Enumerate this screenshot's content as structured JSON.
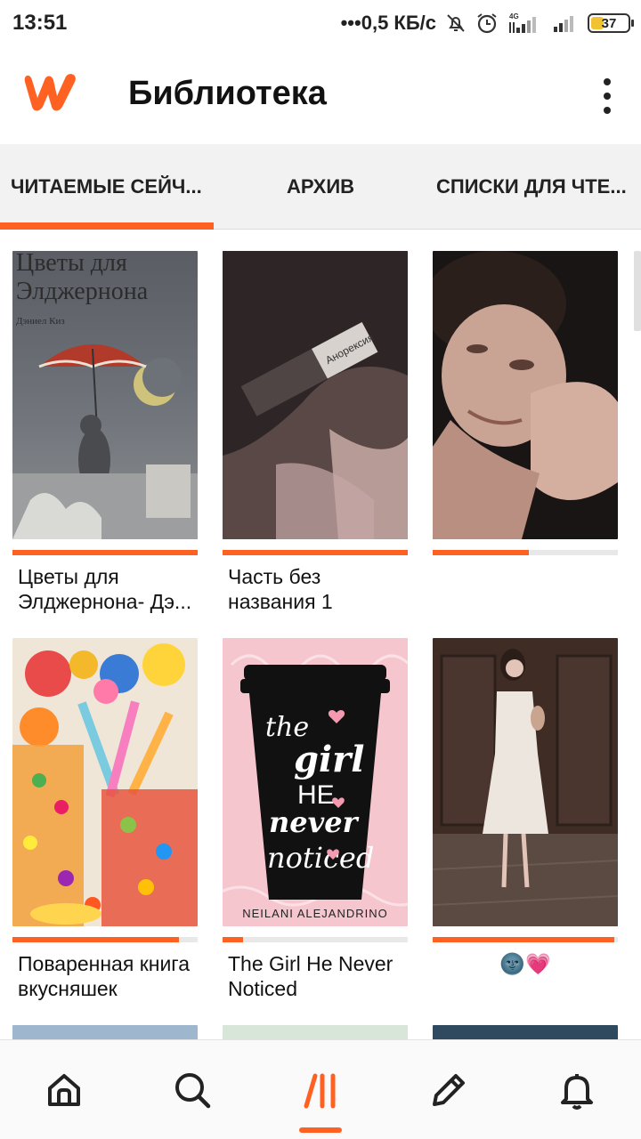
{
  "status_bar": {
    "time": "13:51",
    "speed": "•••0,5 КБ/с",
    "network": "4G",
    "battery": "37"
  },
  "app_bar": {
    "title": "Библиотека",
    "brand_color": "#ff6122"
  },
  "tabs": [
    {
      "label": "ЧИТАЕМЫЕ СЕЙЧ...",
      "active": true
    },
    {
      "label": "АРХИВ",
      "active": false
    },
    {
      "label": "СПИСКИ ДЛЯ ЧТЕ...",
      "active": false
    }
  ],
  "stories": [
    {
      "title": "Цветы для Элджернона- Дэ...",
      "cover_icon": "book-cover-umbrella-cat",
      "cover_text": [
        "Цветы для",
        "Элджернона",
        "Дэниел Киз"
      ],
      "progress_percent": 100
    },
    {
      "title": "Часть без названия 1",
      "cover_icon": "book-cover-dark-photo",
      "cover_text": [
        "Анорексия"
      ],
      "progress_percent": 100
    },
    {
      "title": "",
      "cover_icon": "book-cover-portrait-photo",
      "cover_text": [],
      "progress_percent": 52
    },
    {
      "title": "Поваренная книга вкусняшек",
      "cover_icon": "book-cover-candy-photo",
      "cover_text": [],
      "progress_percent": 90
    },
    {
      "title": "The Girl He Never Noticed",
      "cover_icon": "book-cover-coffee-cup",
      "cover_text": [
        "the",
        "girl",
        "HE",
        "never",
        "noticed",
        "NEILANI ALEJANDRINO"
      ],
      "progress_percent": 11
    },
    {
      "title": "🌚💗",
      "cover_icon": "book-cover-white-dress-photo",
      "cover_text": [],
      "progress_percent": 98
    }
  ],
  "bottom_nav": [
    {
      "icon": "home-icon",
      "active": false
    },
    {
      "icon": "search-icon",
      "active": false
    },
    {
      "icon": "library-icon",
      "active": true
    },
    {
      "icon": "pencil-icon",
      "active": false
    },
    {
      "icon": "bell-icon",
      "active": false
    }
  ]
}
